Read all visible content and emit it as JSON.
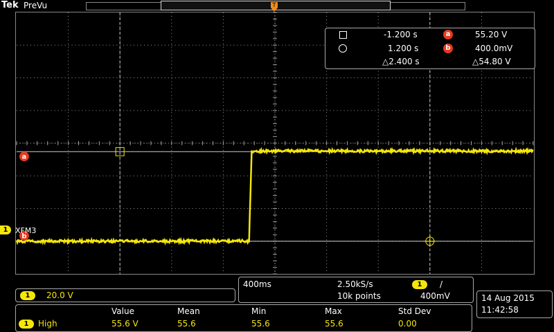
{
  "header": {
    "brand": "Tek",
    "mode": "PreVu",
    "trigger_marker": "T"
  },
  "cursor_readout": {
    "cursor1_time": "-1.200 s",
    "cursor1_value": "55.20 V",
    "cursor2_time": "1.200 s",
    "cursor2_value": "400.0mV",
    "delta_time": "△2.400 s",
    "delta_value": "△54.80 V",
    "label_a": "a",
    "label_b": "b"
  },
  "channel": {
    "number": "1",
    "name": "XFM3",
    "scale": "20.0 V"
  },
  "acquisition": {
    "timebase": "400ms",
    "sample_rate": "2.50kS/s",
    "record_length": "10k points",
    "trigger_channel": "1",
    "trigger_slope": "/",
    "trigger_level": "400mV"
  },
  "datetime": {
    "date": "14 Aug  2015",
    "time": "11:42:58"
  },
  "measurements": {
    "headers": [
      "Value",
      "Mean",
      "Min",
      "Max",
      "Std Dev"
    ],
    "rows": [
      {
        "channel": "1",
        "name": "High",
        "values": [
          "55.6 V",
          "55.6",
          "55.6",
          "55.6",
          "0.00"
        ]
      }
    ]
  },
  "colors": {
    "trace": "#f5e60a",
    "cursor_marker": "#e43a1e",
    "grid": "#9a9a9a",
    "trigger": "#f08c1e"
  },
  "chart_data": {
    "type": "line",
    "series": [
      {
        "x": [
          -2.0,
          -0.2,
          -0.18,
          2.0
        ],
        "y": [
          0.4,
          0.4,
          55.6,
          55.6
        ]
      }
    ],
    "xlim": [
      -2.0,
      2.0
    ],
    "ylim": [
      -19.6,
      140.4
    ],
    "grid": true,
    "cursors_x": [
      -1.2,
      1.2
    ],
    "cursors_y": [
      55.2,
      0.4
    ]
  }
}
